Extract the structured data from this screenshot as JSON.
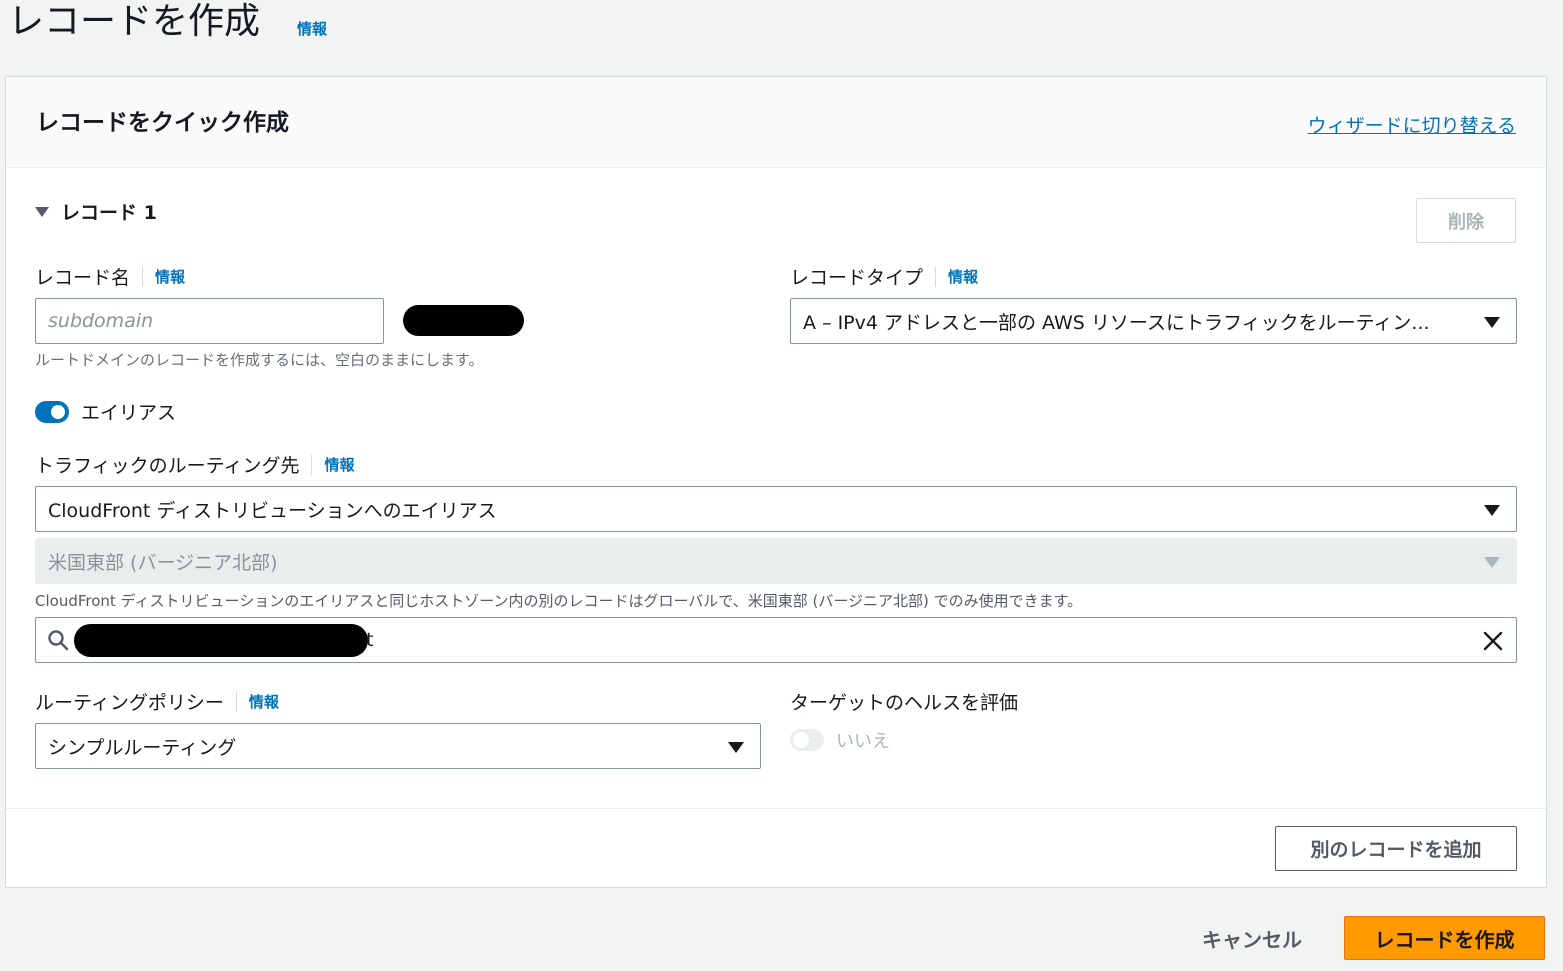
{
  "page": {
    "title": "レコードを作成",
    "info_label": "情報"
  },
  "panel": {
    "title": "レコードをクイック作成",
    "wizard_link": "ウィザードに切り替える"
  },
  "record": {
    "heading": "レコード 1",
    "delete_label": "削除",
    "name": {
      "label": "レコード名",
      "info": "情報",
      "placeholder": "subdomain",
      "hint": "ルートドメインのレコードを作成するには、空白のままにします。"
    },
    "type": {
      "label": "レコードタイプ",
      "info": "情報",
      "value": "A – IPv4 アドレスと一部の AWS リソースにトラフィックをルーティン..."
    },
    "alias": {
      "label": "エイリアス",
      "enabled": true
    },
    "route_target": {
      "label": "トラフィックのルーティング先",
      "info": "情報",
      "value": "CloudFront ディストリビューションへのエイリアス",
      "region_value": "米国東部 (バージニア北部)",
      "hint": "CloudFront ディストリビューションのエイリアスと同じホストゾーン内の別のレコードはグローバルで、米国東部 (バージニア北部) でのみ使用できます。",
      "search_suffix": "t"
    },
    "routing_policy": {
      "label": "ルーティングポリシー",
      "info": "情報",
      "value": "シンプルルーティング"
    },
    "health_check": {
      "label": "ターゲットのヘルスを評価",
      "value": "いいえ",
      "enabled": false
    }
  },
  "footer": {
    "add_record": "別のレコードを追加"
  },
  "actions": {
    "cancel": "キャンセル",
    "create": "レコードを作成"
  },
  "colors": {
    "primary": "#ff9900",
    "link": "#0073bb",
    "toggle_on": "#0073bb"
  }
}
